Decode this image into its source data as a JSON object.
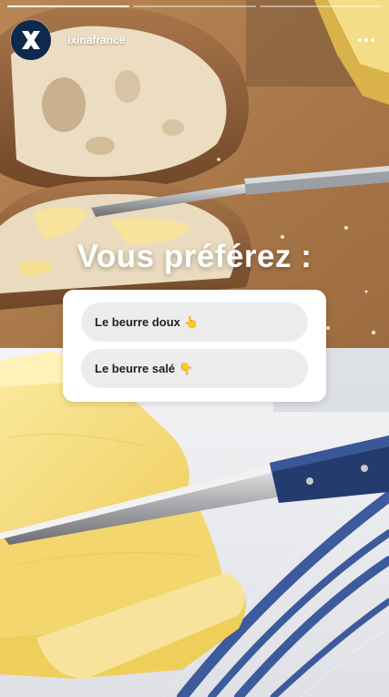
{
  "header": {
    "username": "ixinafrance",
    "avatar_icon": "ixina-logo-icon",
    "more_icon": "more-options-icon"
  },
  "progress": {
    "segments": 3,
    "active_index": 0,
    "active_fill": 1.0
  },
  "question": "Vous préférez :",
  "poll": {
    "options": [
      {
        "label": "Le beurre doux",
        "emoji": "👆"
      },
      {
        "label": "Le beurre salé",
        "emoji": "👇"
      }
    ]
  },
  "colors": {
    "brand_navy": "#0d2a4c",
    "poll_option_bg": "#ececec"
  }
}
